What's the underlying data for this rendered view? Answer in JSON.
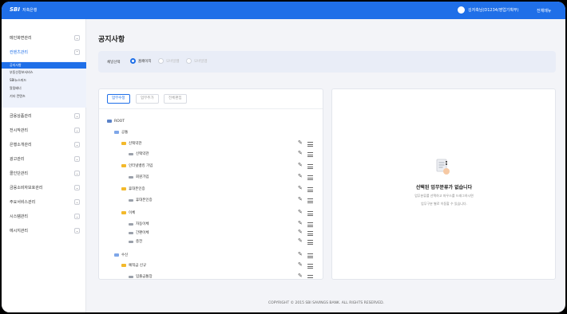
{
  "header": {
    "logo_mark": "SBI",
    "logo_text": "저축은행",
    "user_name": "김저축님(D1234/영업기획부)",
    "all_menu": "전체메뉴"
  },
  "sidebar": {
    "items": [
      {
        "label": "메인화면관리",
        "chevron": "⌄"
      },
      {
        "label": "컨텐츠관리",
        "chevron": "⌃"
      },
      {
        "label": "금융상품관리",
        "chevron": "⌄"
      },
      {
        "label": "전시작관리",
        "chevron": "⌄"
      },
      {
        "label": "은행소개관리",
        "chevron": "⌄"
      },
      {
        "label": "광고관리",
        "chevron": "⌄"
      },
      {
        "label": "콜인단관리",
        "chevron": "⌄"
      },
      {
        "label": "금융소비자보호관리",
        "chevron": "⌄"
      },
      {
        "label": "주요서비스관리",
        "chevron": "⌄"
      },
      {
        "label": "시스템관리",
        "chevron": "⌄"
      },
      {
        "label": "에시지관리",
        "chevron": "⌄"
      }
    ],
    "sub_items": [
      {
        "label": "공지사항"
      },
      {
        "label": "부동산정보서비스"
      },
      {
        "label": "SBI뉴스피드"
      },
      {
        "label": "알림배너"
      },
      {
        "label": "기타 컨텐츠"
      }
    ]
  },
  "page": {
    "title": "공지사항",
    "channel_label": "채널선택",
    "radios": [
      {
        "label": "홈페이지",
        "checked": true
      },
      {
        "label": "모바일웹",
        "checked": false
      },
      {
        "label": "모바일앱",
        "checked": false
      }
    ]
  },
  "tabs": [
    "업무수정",
    "업무추가",
    "전체편집"
  ],
  "tree": [
    {
      "label": "ROOT",
      "type": "root",
      "actions": false
    },
    {
      "label": "공통",
      "type": "blue",
      "actions": false
    },
    {
      "label": "신택약관",
      "type": "yellow",
      "actions": true
    },
    {
      "label": "신택약관",
      "type": "leaf",
      "actions": true
    },
    {
      "label": "인터넷뱅킹 가입",
      "type": "yellow",
      "actions": true
    },
    {
      "label": "회원가입",
      "type": "leaf",
      "actions": true
    },
    {
      "label": "휴대폰인증",
      "type": "yellow",
      "actions": true
    },
    {
      "label": "휴대폰인증",
      "type": "leaf",
      "actions": true
    },
    {
      "label": "이체",
      "type": "yellow",
      "actions": true
    },
    {
      "label": "자동이체",
      "type": "leaf",
      "actions": true
    },
    {
      "label": "간편이체",
      "type": "leaf",
      "actions": true
    },
    {
      "label": "충전",
      "type": "leaf",
      "actions": true
    },
    {
      "label": "수신",
      "type": "blue",
      "actions": true
    },
    {
      "label": "예적금 신규",
      "type": "yellow",
      "actions": true
    },
    {
      "label": "입출금통장",
      "type": "leaf",
      "actions": true
    }
  ],
  "empty_state": {
    "title": "선택된 업무분류가 없습니다",
    "desc_line1": "업무분류를 선택하고 마우스를 드래그하시면",
    "desc_line2": "업무구분 별로 이동할 수 있습니다."
  },
  "footer": "COPYRIGHT © 2015 SBI SAVINGS BANK. ALL RIGHTS RESERVED.",
  "colors": {
    "primary": "#1f6fe8",
    "folder": "#f3b92b",
    "folder_blue": "#7ea6e8"
  }
}
